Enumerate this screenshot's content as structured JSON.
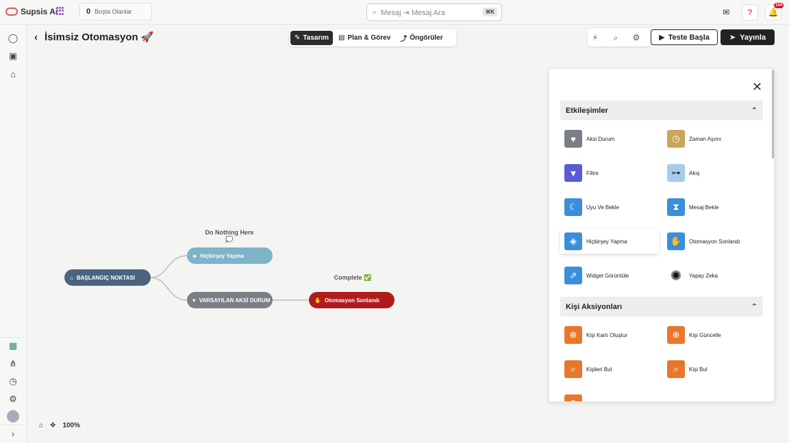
{
  "topbar": {
    "brand": "Supsis Ai",
    "online_count": "0",
    "online_label": "Boşta Olanlar",
    "search_placeholder": "Mesaj ⇥ Mesaj Ara",
    "search_kbd": "⌘K",
    "notif_badge": "104"
  },
  "page": {
    "title": "İsimsiz Otomasyon 🚀",
    "zoom": "100%"
  },
  "tabs": [
    {
      "label": "Tasarım"
    },
    {
      "label": "Plan & Görev"
    },
    {
      "label": "Öngörüler"
    }
  ],
  "actions": {
    "test": "Teste Başla",
    "publish": "Yayınla"
  },
  "flow": {
    "start": "BAŞLANGIÇ NOKTASI",
    "nothing": "Hiçbirşey Yapma",
    "nothing_note": "Do Nothing Here",
    "default": "VARSAYILAN AKSİ DURUM",
    "end": "Otomasyon Sonlandı",
    "end_note": "Complete ✅"
  },
  "panel": {
    "sec1": "Etkileşimler",
    "sec2": "Kişi Aksiyonları",
    "items1": [
      "Aksi Durum",
      "Zaman Aşımı",
      "Filtre",
      "Akış",
      "Uyu Ve Bekle",
      "Mesaj Bekle",
      "Hiçbirşey Yapma",
      "Otomasyon Sonlandı",
      "Widget Görüntüle",
      "Yapay Zeka"
    ],
    "items2": [
      "Kişi Kartı Oluştur",
      "Kişi Güncelle",
      "Kişileri Bul",
      "Kişi Bul"
    ]
  },
  "colors": {
    "accent_blue": "#3b8fd9",
    "start_node": "#4a6480",
    "nothing_node": "#7fb3c9",
    "default_node": "#7a7f86",
    "end_node": "#b01c1c",
    "orange": "#e9772b",
    "purple": "#5b5bd6",
    "gold": "#c9a65a"
  }
}
